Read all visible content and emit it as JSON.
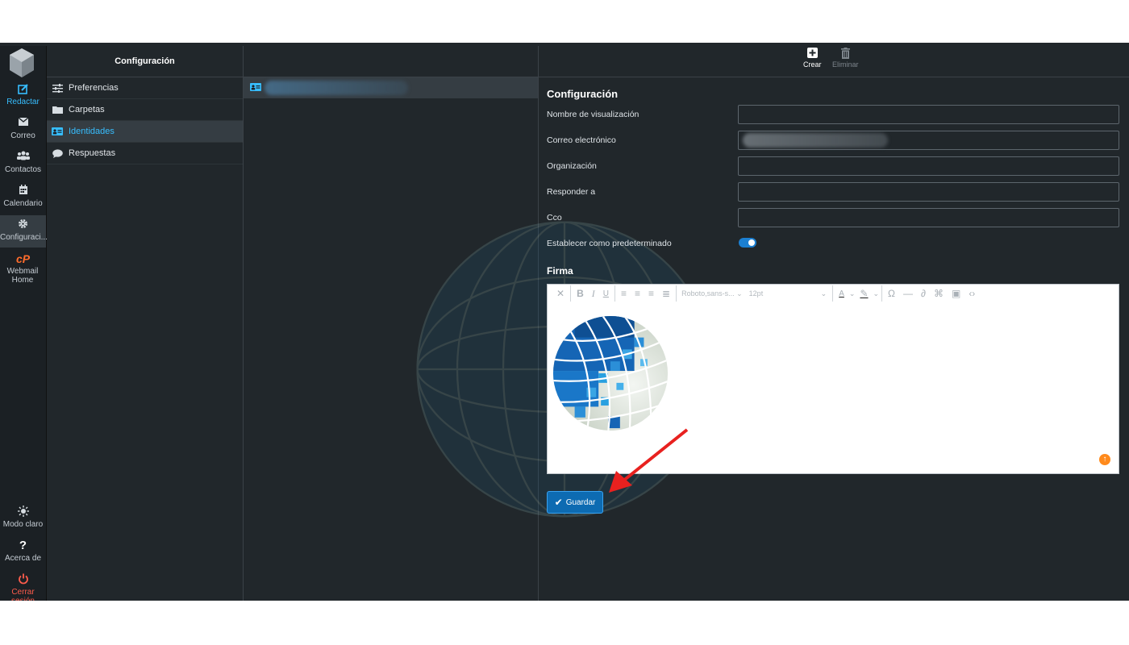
{
  "nav": {
    "items": [
      {
        "label": "Redactar",
        "icon": "compose-icon"
      },
      {
        "label": "Correo",
        "icon": "envelope-icon"
      },
      {
        "label": "Contactos",
        "icon": "users-icon"
      },
      {
        "label": "Calendario",
        "icon": "calendar-icon"
      },
      {
        "label": "Configuraci...",
        "icon": "gear-icon"
      },
      {
        "label": "Webmail Home",
        "icon": "cpanel-icon",
        "icon_text": "cP"
      }
    ],
    "bottom": [
      {
        "label": "Modo claro",
        "icon": "sun-icon"
      },
      {
        "label": "Acerca de",
        "icon": "question-icon"
      },
      {
        "label": "Cerrar sesión",
        "icon": "power-icon"
      }
    ]
  },
  "settings": {
    "title": "Configuración",
    "items": [
      {
        "label": "Preferencias",
        "icon": "sliders-icon"
      },
      {
        "label": "Carpetas",
        "icon": "folder-icon"
      },
      {
        "label": "Identidades",
        "icon": "id-card-icon",
        "active": true
      },
      {
        "label": "Respuestas",
        "icon": "comment-icon"
      }
    ]
  },
  "toolbar": {
    "create_label": "Crear",
    "delete_label": "Eliminar"
  },
  "form": {
    "title": "Configuración",
    "fields": [
      {
        "label": "Nombre de visualización",
        "value": ""
      },
      {
        "label": "Correo electrónico",
        "value": ""
      },
      {
        "label": "Organización",
        "value": ""
      },
      {
        "label": "Responder a",
        "value": ""
      },
      {
        "label": "Cco",
        "value": ""
      }
    ],
    "default_label": "Establecer como predeterminado",
    "default_on": true,
    "signature_title": "Firma",
    "editor": {
      "font_family": "Roboto,sans-s...",
      "font_size": "12pt"
    },
    "save_label": "Guardar"
  },
  "colors": {
    "accent": "#37beff",
    "logout": "#ff5c4c",
    "save_button": "#0d6bb2",
    "arrow": "#e8211f"
  }
}
